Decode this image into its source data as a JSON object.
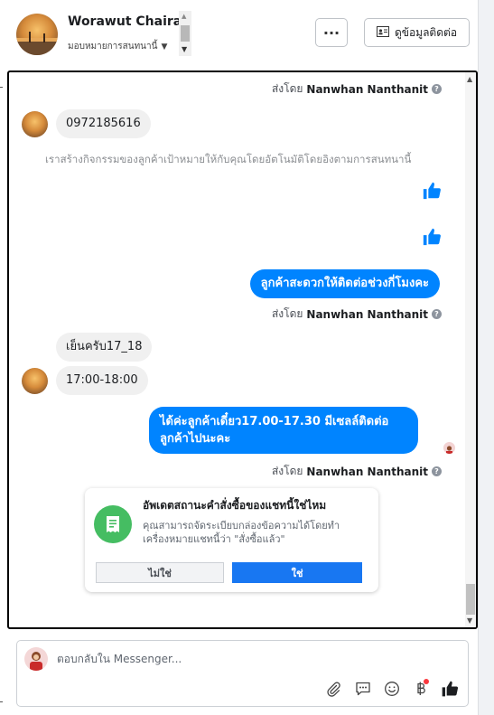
{
  "header": {
    "contact_name": "Worawut Chairat",
    "assign_label": "มอบหมายการสนทนานี้",
    "contact_info_label": "ดูข้อมูลติดต่อ",
    "more_label": "···"
  },
  "chat": {
    "sent_by_prefix": "ส่งโดย",
    "agent_name": "Nanwhan Nanthanit",
    "help_mark": "?",
    "messages": {
      "phone": "0972185616",
      "system_note": "เราสร้างกิจกรรมของลูกค้าเป้าหมายให้กับคุณโดยอัตโนมัติโดยอิงตามการสนทนานี้",
      "out_1": "ลูกค้าสะดวกให้ติดต่อช่วงกี่โมงคะ",
      "in_1": "เย็นครับ17_18",
      "in_2": "17:00-18:00",
      "out_2": "ได้ค่ะลูกค้าเดี๋ยว17.00-17.30 มีเซลล์ติดต่อลูกค้าไปนะคะ"
    },
    "order_card": {
      "title": "อัพเดตสถานะคำสั่งซื้อของแชทนี้ใช่ไหม",
      "text": "คุณสามารถจัดระเบียบกล่องข้อความได้โดยทำเครื่องหมายแชทนี้ว่า \"สั่งซื้อแล้ว\"",
      "no_label": "ไม่ใช่",
      "yes_label": "ใช่"
    }
  },
  "composer": {
    "placeholder": "ตอบกลับใน Messenger...",
    "value": ""
  },
  "colors": {
    "outgoing_bubble": "#0084ff",
    "incoming_bubble": "#f0f0f0",
    "primary_button": "#1877f2",
    "order_icon": "#45bd62"
  }
}
